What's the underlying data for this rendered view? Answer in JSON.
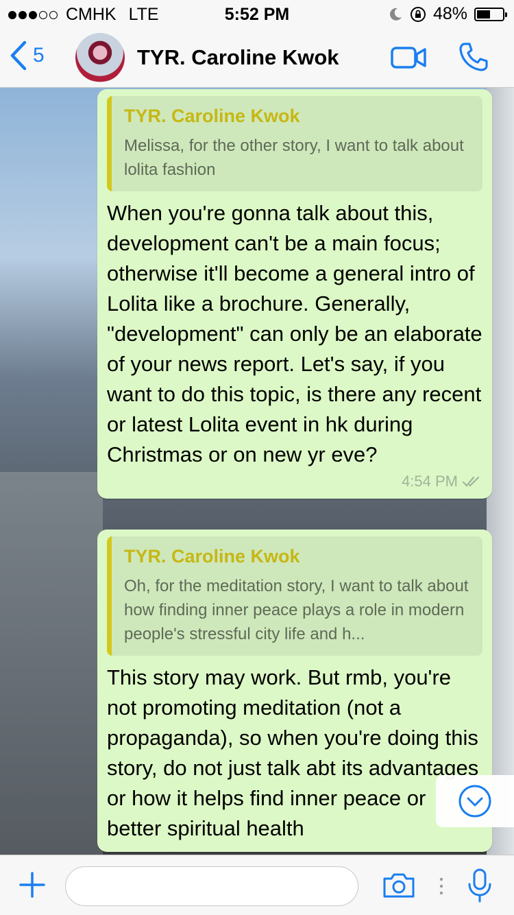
{
  "status_bar": {
    "carrier": "CMHK",
    "network": "LTE",
    "time": "5:52 PM",
    "battery": "48%",
    "battery_level": 0.48,
    "signal_bars_filled": 3,
    "signal_bars_total": 5
  },
  "header": {
    "back_count": "5",
    "contact_name": "TYR. Caroline Kwok",
    "video_call_icon": "video-camera-icon",
    "voice_call_icon": "phone-icon"
  },
  "messages": [
    {
      "quote_author": "TYR. Caroline Kwok",
      "quote_text": "Melissa, for the other story, I want to talk about lolita fashion",
      "text": "When you're gonna talk about this, development can't be a main focus; otherwise it'll become a general intro of Lolita like a brochure. Generally, \"development\" can only be an elaborate of your news report. Let's say, if you want to do this topic, is there any recent or latest Lolita event in hk during Christmas or on new yr eve?",
      "time": "4:54 PM"
    },
    {
      "quote_author": "TYR. Caroline Kwok",
      "quote_text": "Oh, for the meditation story, I want to talk about how finding inner peace plays a role in modern people's stressful city life and h...",
      "text": "This story may work. But rmb, you're not promoting meditation (not a propaganda), so when you're doing this story, do not just talk abt its advantages or how it helps find inner peace or better spiritual health"
    }
  ],
  "colors": {
    "accent": "#1a7ef0",
    "bubble": "#dcf8c6",
    "quote_bar": "#d3c81d",
    "quote_author": "#c6b714"
  }
}
